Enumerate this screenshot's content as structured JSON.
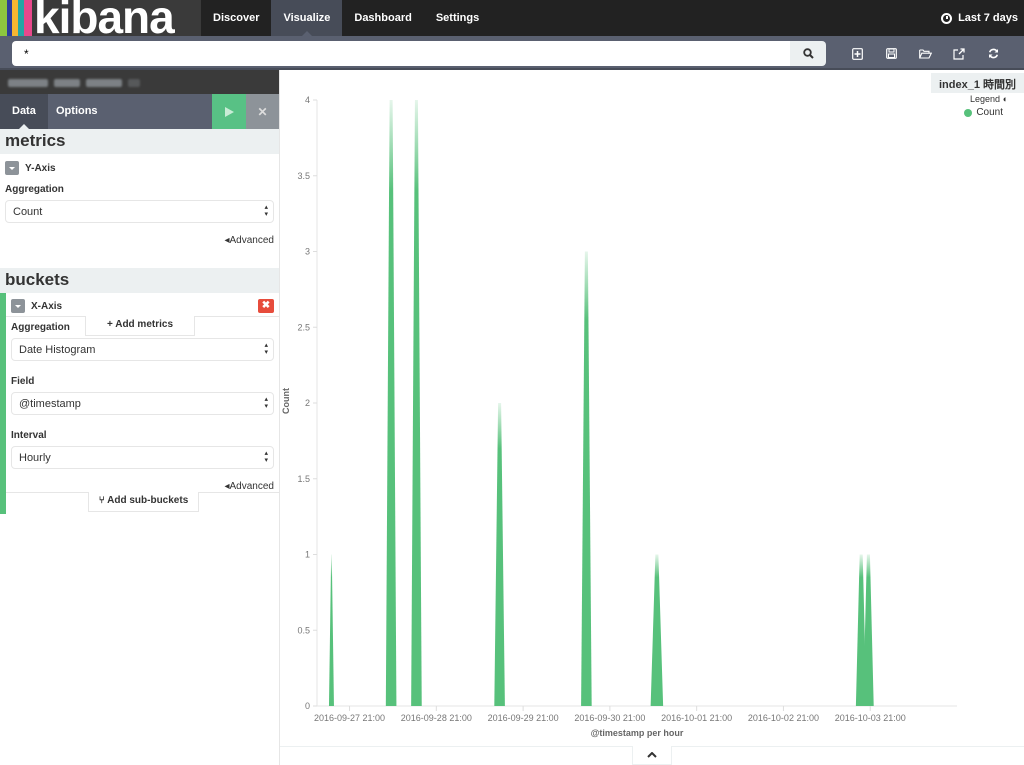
{
  "topnav": {
    "logo_text": "kibana",
    "logo_stripes": [
      "#8dc63f",
      "#2d3e99",
      "#f7b731",
      "#25a6a4",
      "#e8488b"
    ],
    "links": [
      {
        "label": "Discover",
        "active": false
      },
      {
        "label": "Visualize",
        "active": true
      },
      {
        "label": "Dashboard",
        "active": false
      },
      {
        "label": "Settings",
        "active": false
      }
    ],
    "timepicker": {
      "icon": "clock-icon",
      "label": "Last 7 days"
    }
  },
  "search": {
    "query": "*",
    "search_icon": "search-icon",
    "tools": [
      {
        "name": "new-visualization",
        "icon": "plus-square-icon"
      },
      {
        "name": "save-visualization",
        "icon": "save-icon"
      },
      {
        "name": "load-visualization",
        "icon": "folder-open-icon"
      },
      {
        "name": "share-visualization",
        "icon": "external-link-icon"
      },
      {
        "name": "refresh",
        "icon": "refresh-icon"
      }
    ]
  },
  "sidebar": {
    "title_redacted": true,
    "tabs": [
      {
        "label": "Data",
        "active": true
      },
      {
        "label": "Options",
        "active": false
      }
    ],
    "apply_icon": "play-icon",
    "discard_icon": "close-icon",
    "metrics": {
      "heading": "metrics",
      "agg_title": "Y-Axis",
      "aggregation_label": "Aggregation",
      "aggregation_value": "Count",
      "advanced_label": "Advanced",
      "add_label": "Add metrics"
    },
    "buckets": {
      "heading": "buckets",
      "agg_title": "X-Axis",
      "aggregation_label": "Aggregation",
      "aggregation_value": "Date Histogram",
      "field_label": "Field",
      "field_value": "@timestamp",
      "interval_label": "Interval",
      "interval_value": "Hourly",
      "advanced_label": "Advanced",
      "add_label": "Add sub-buckets",
      "remove_icon": "close-icon"
    }
  },
  "chart_header": {
    "title": "index_1 時間別",
    "legend_label": "Legend",
    "legend_items": [
      {
        "label": "Count",
        "color": "#57c17b"
      }
    ]
  },
  "chart_data": {
    "type": "area",
    "title": "index_1 時間別",
    "xlabel": "@timestamp per hour",
    "ylabel": "Count",
    "ylim": [
      0,
      4
    ],
    "yticks": [
      "0",
      "0.5",
      "1",
      "1.5",
      "2",
      "2.5",
      "3",
      "3.5",
      "4"
    ],
    "ytick_values": [
      0,
      0.5,
      1,
      1.5,
      2,
      2.5,
      3,
      3.5,
      4
    ],
    "xticks": [
      "2016-09-27 21:00",
      "2016-09-28 21:00",
      "2016-09-29 21:00",
      "2016-09-30 21:00",
      "2016-10-01 21:00",
      "2016-10-02 21:00",
      "2016-10-03 21:00"
    ],
    "x_range_hours_from_first_tick": [
      -9,
      168
    ],
    "grid": false,
    "legend": "top-right",
    "series": [
      {
        "name": "Count",
        "color": "#57c17b",
        "points": [
          {
            "hour_offset": -5,
            "value": 1,
            "width_hours": 0.5
          },
          {
            "hour_offset": 11.5,
            "value": 4,
            "width_hours": 2
          },
          {
            "hour_offset": 18.5,
            "value": 4,
            "width_hours": 2
          },
          {
            "hour_offset": 41.5,
            "value": 2,
            "width_hours": 2
          },
          {
            "hour_offset": 65.5,
            "value": 3,
            "width_hours": 2
          },
          {
            "hour_offset": 85,
            "value": 1,
            "width_hours": 2.5
          },
          {
            "hour_offset": 141.5,
            "value": 1,
            "width_hours": 2
          },
          {
            "hour_offset": 143.5,
            "value": 1,
            "width_hours": 2
          }
        ]
      }
    ]
  }
}
